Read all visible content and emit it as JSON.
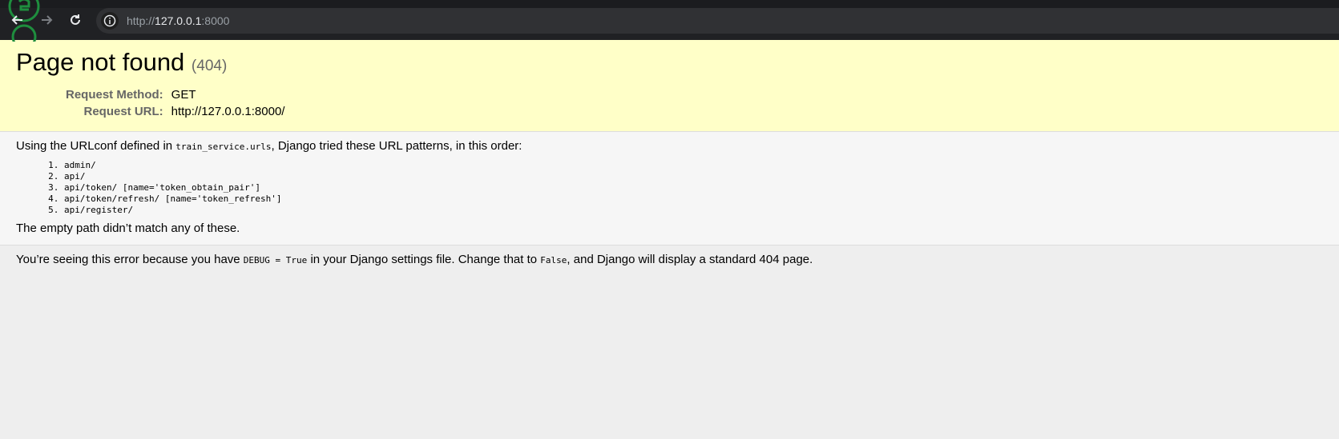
{
  "browser": {
    "url_scheme": "http://",
    "url_host": "127.0.0.1",
    "url_port": ":8000"
  },
  "error": {
    "title": "Page not found",
    "code": "(404)",
    "request_method_label": "Request Method:",
    "request_method": "GET",
    "request_url_label": "Request URL:",
    "request_url": "http://127.0.0.1:8000/"
  },
  "info": {
    "intro_prefix": "Using the URLconf defined in ",
    "urlconf": "train_service.urls",
    "intro_suffix": ", Django tried these URL patterns, in this order:",
    "patterns": [
      "admin/",
      "api/",
      "api/token/ [name='token_obtain_pair']",
      "api/token/refresh/ [name='token_refresh']",
      "api/register/"
    ],
    "no_match": "The empty path didn’t match any of these."
  },
  "explanation": {
    "part1": "You’re seeing this error because you have ",
    "debug_code": "DEBUG = True",
    "part2": " in your Django settings file. Change that to ",
    "false_code": "False",
    "part3": ", and Django will display a standard 404 page."
  },
  "icons": {
    "back": "arrow-left-icon",
    "forward": "arrow-right-icon",
    "reload": "reload-icon",
    "info": "info-circle-icon",
    "tab_favicon": "python-logo-icon"
  }
}
